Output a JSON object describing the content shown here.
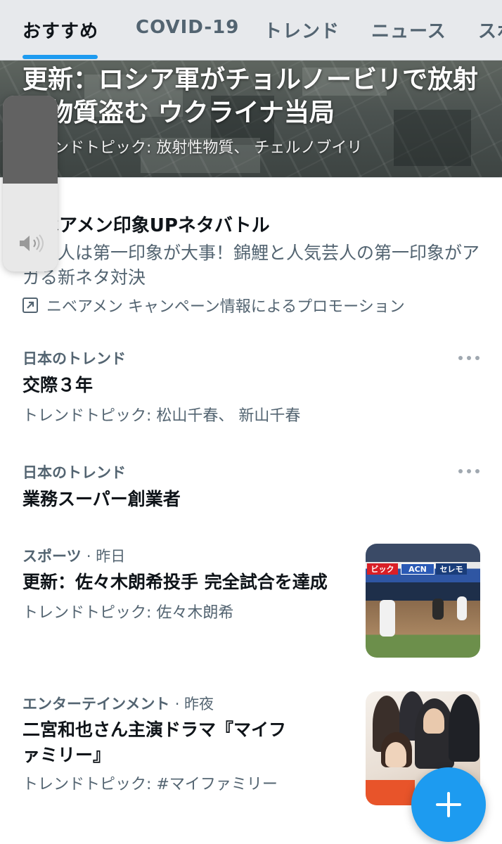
{
  "tabs": [
    {
      "label": "おすすめ",
      "active": true
    },
    {
      "label": "COVID-19",
      "active": false
    },
    {
      "label": "トレンド",
      "active": false
    },
    {
      "label": "ニュース",
      "active": false
    },
    {
      "label": "スポ",
      "active": false
    }
  ],
  "hero": {
    "title": "更新：ロシア軍がチョルノービリで放射性物質盗む ウクライナ当局",
    "subtitle": "トレンドトピック: 放射性物質、 チェルノブイリ"
  },
  "volume": {
    "level": 0.5,
    "icon": "speaker-icon"
  },
  "promo": {
    "title": "ニベアメン印象UPネタバトル",
    "description": "社会人は第一印象が大事！錦鯉と人気芸人の第一印象がアガる新ネタ対決",
    "promoted_by": "ニベアメン キャンペーン情報によるプロモーション",
    "icon": "promoted-arrow-icon"
  },
  "trends": [
    {
      "context": "日本のトレンド",
      "title": "交際３年",
      "topic": "トレンドトピック: 松山千春、 新山千春"
    },
    {
      "context": "日本のトレンド",
      "title": "業務スーパー創業者",
      "topic": ""
    }
  ],
  "news": [
    {
      "category": "スポーツ",
      "time": "· 昨日",
      "title": "更新：佐々木朗希投手 完全試合を達成",
      "topic": "トレンドトピック: 佐々木朗希"
    },
    {
      "category": "エンターテインメント",
      "time": "· 昨夜",
      "title": "二宮和也さん主演ドラマ『マイファミリー』",
      "topic": "トレンドトピック: #マイファミリー"
    }
  ],
  "fab": {
    "icon": "plus-icon"
  },
  "colors": {
    "accent": "#1d9bf0",
    "secondary_text": "#536471",
    "primary_text": "#0f1419"
  }
}
